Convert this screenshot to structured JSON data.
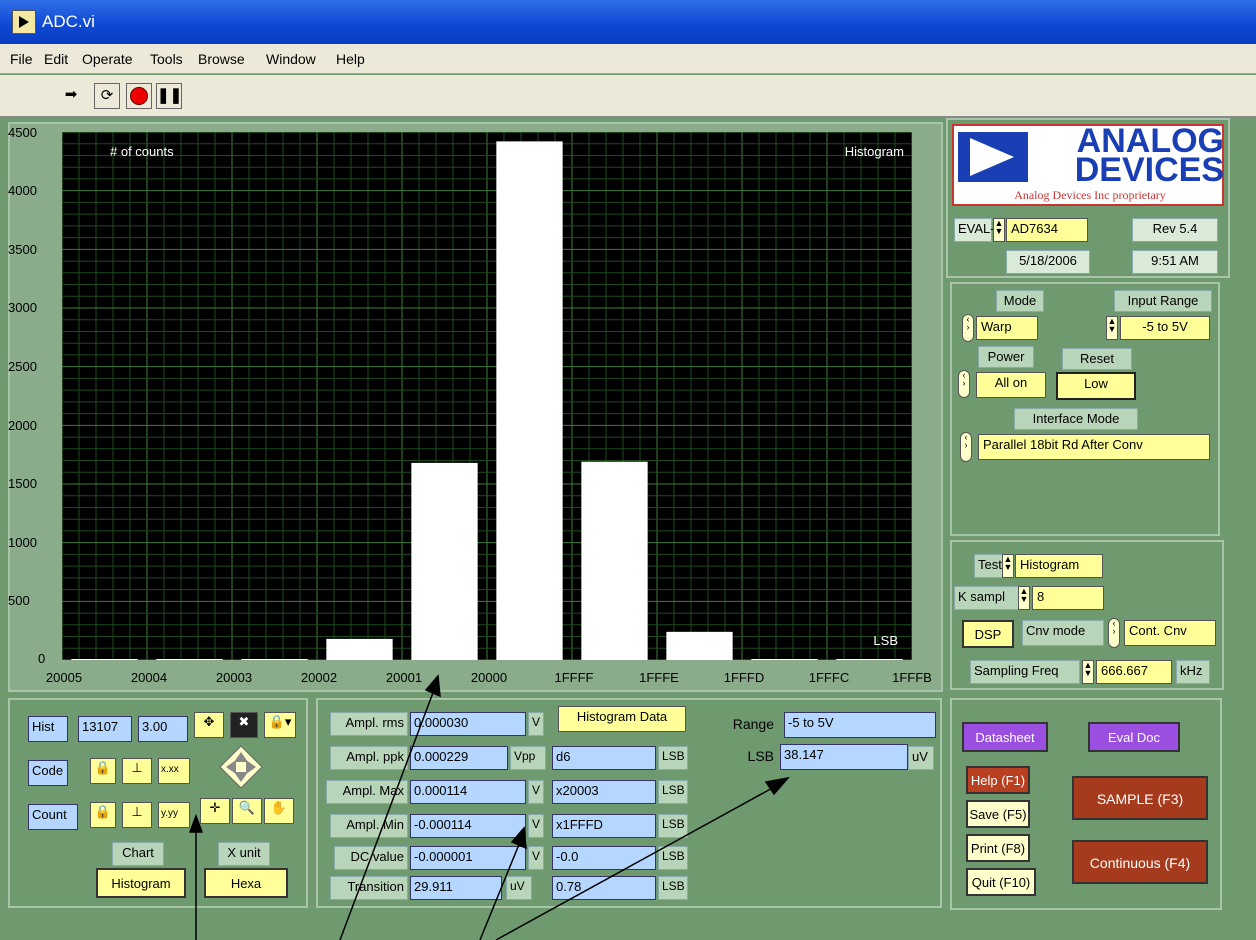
{
  "window": {
    "title": "ADC.vi"
  },
  "menu": [
    "File",
    "Edit",
    "Operate",
    "Tools",
    "Browse",
    "Window",
    "Help"
  ],
  "graph": {
    "ylabel": "# of counts",
    "title": "Histogram",
    "xunit": "LSB",
    "yticks": [
      "4500",
      "4000",
      "3500",
      "3000",
      "2500",
      "2000",
      "1500",
      "1000",
      "500",
      "0"
    ],
    "xticks": [
      "20005",
      "20004",
      "20003",
      "20002",
      "20001",
      "20000",
      "1FFFF",
      "1FFFE",
      "1FFFD",
      "1FFFC",
      "1FFFB"
    ]
  },
  "chart_data": {
    "type": "bar",
    "title": "Histogram",
    "xlabel": "LSB",
    "ylabel": "# of counts",
    "categories": [
      "20005",
      "20004",
      "20003",
      "20002",
      "20001",
      "20000",
      "1FFFF",
      "1FFFE",
      "1FFFD",
      "1FFFC"
    ],
    "values": [
      5,
      5,
      6,
      180,
      1680,
      4420,
      1690,
      240,
      5,
      5
    ],
    "ylim": [
      0,
      4500
    ],
    "grid": true
  },
  "logo": {
    "line1": "ANALOG",
    "line2": "DEVICES",
    "tag": "Analog Devices Inc proprietary"
  },
  "device": {
    "eval_label": "EVAL-",
    "part": "AD7634",
    "rev": "Rev 5.4",
    "date": "5/18/2006",
    "time": "9:51 AM"
  },
  "settings": {
    "mode_label": "Mode",
    "mode_value": "Warp",
    "input_range_label": "Input Range",
    "input_range_value": "-5 to 5V",
    "power_label": "Power",
    "power_value": "All on",
    "reset_label": "Reset",
    "reset_value": "Low",
    "interface_label": "Interface Mode",
    "interface_value": "Parallel 18bit Rd After Conv"
  },
  "test": {
    "test_label": "Test",
    "test_value": "Histogram",
    "ksampl_label": "K sampl",
    "ksampl_value": "8",
    "dsp_label": "DSP",
    "cnv_label": "Cnv mode",
    "cnv_value": "Cont. Cnv",
    "freq_label": "Sampling Freq",
    "freq_value": "666.667",
    "freq_unit": "kHz"
  },
  "cursor": {
    "hist_label": "Hist",
    "hist_val1": "13107",
    "hist_val2": "3.00",
    "code_label": "Code",
    "count_label": "Count",
    "fmt": "x.xx",
    "fmt2": "y.yy",
    "chart_label": "Chart",
    "chart_value": "Histogram",
    "xunit_label": "X unit",
    "xunit_value": "Hexa"
  },
  "measure": {
    "rows": [
      {
        "label": "Ampl. rms",
        "value": "0.000030",
        "unit": "V"
      },
      {
        "label": "Ampl. ppk",
        "value": "0.000229",
        "unit": "Vpp",
        "lsb": "d6",
        "lsb_unit": "LSB"
      },
      {
        "label": "Ampl. Max",
        "value": "0.000114",
        "unit": "V",
        "lsb": "x20003",
        "lsb_unit": "LSB"
      },
      {
        "label": "Ampl. Min",
        "value": "-0.000114",
        "unit": "V",
        "lsb": "x1FFFD",
        "lsb_unit": "LSB"
      },
      {
        "label": "DC value",
        "value": "-0.000001",
        "unit": "V",
        "lsb": "-0.0",
        "lsb_unit": "LSB"
      },
      {
        "label": "Transition",
        "value": "29.911",
        "unit": "uV",
        "lsb": "0.78",
        "lsb_unit": "LSB"
      }
    ],
    "hist_data_label": "Histogram Data",
    "range_label": "Range",
    "range_value": "-5 to 5V",
    "lsb_label": "LSB",
    "lsb_value": "38.147",
    "lsb_unit": "uV"
  },
  "actions": {
    "datasheet": "Datasheet",
    "evaldoc": "Eval Doc",
    "help": "Help (F1)",
    "save": "Save (F5)",
    "print": "Print (F8)",
    "quit": "Quit (F10)",
    "sample": "SAMPLE (F3)",
    "continuous": "Continuous (F4)"
  }
}
